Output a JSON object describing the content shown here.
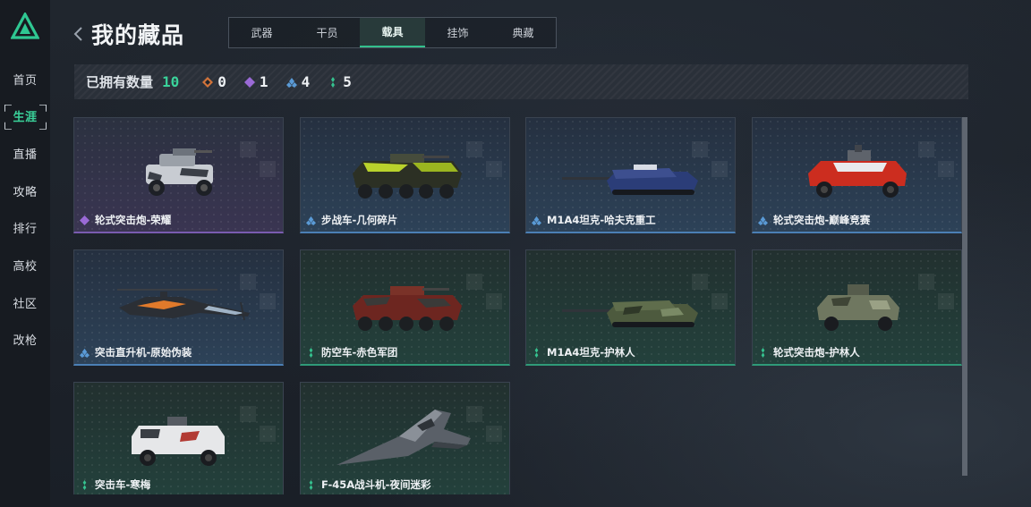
{
  "app": {
    "logo_icon": "triangle-logo-icon",
    "brand_color": "#3ad29a"
  },
  "sidebar": {
    "items": [
      {
        "label": "首页",
        "active": false
      },
      {
        "label": "生涯",
        "active": true
      },
      {
        "label": "直播",
        "active": false
      },
      {
        "label": "攻略",
        "active": false
      },
      {
        "label": "排行",
        "active": false
      },
      {
        "label": "高校",
        "active": false
      },
      {
        "label": "社区",
        "active": false
      },
      {
        "label": "改枪",
        "active": false
      }
    ]
  },
  "header": {
    "back_icon": "chevron-left-icon",
    "title": "我的藏品",
    "tabs": [
      {
        "label": "武器",
        "active": false
      },
      {
        "label": "干员",
        "active": false
      },
      {
        "label": "载具",
        "active": true
      },
      {
        "label": "挂饰",
        "active": false
      },
      {
        "label": "典藏",
        "active": false
      }
    ]
  },
  "stats": {
    "owned_label": "已拥有数量",
    "owned_total": "10",
    "rarities": [
      {
        "icon": "orange-diamond-icon",
        "color": "#d3743a",
        "count": "0"
      },
      {
        "icon": "purple-diamond-icon",
        "color": "#9a6ad6",
        "count": "1"
      },
      {
        "icon": "blue-diamond-icon",
        "color": "#5a9ad6",
        "count": "4"
      },
      {
        "icon": "green-diamond-icon",
        "color": "#35c28f",
        "count": "5"
      }
    ]
  },
  "collection": {
    "items": [
      {
        "name": "轮式突击炮-荣耀",
        "rarity": "purple",
        "vehicle": "armored-car"
      },
      {
        "name": "步战车-几何碎片",
        "rarity": "blue",
        "vehicle": "ifv"
      },
      {
        "name": "M1A4坦克-哈夫克重工",
        "rarity": "blue",
        "vehicle": "tank"
      },
      {
        "name": "轮式突击炮-巅峰竞赛",
        "rarity": "blue",
        "vehicle": "armored-car"
      },
      {
        "name": "突击直升机-原始伪装",
        "rarity": "blue",
        "vehicle": "helicopter"
      },
      {
        "name": "防空车-赤色军团",
        "rarity": "green",
        "vehicle": "ifv"
      },
      {
        "name": "M1A4坦克-护林人",
        "rarity": "green",
        "vehicle": "tank"
      },
      {
        "name": "轮式突击炮-护林人",
        "rarity": "green",
        "vehicle": "armored-car"
      },
      {
        "name": "突击车-寒梅",
        "rarity": "green",
        "vehicle": "mrap"
      },
      {
        "name": "F-45A战斗机-夜间迷彩",
        "rarity": "green",
        "vehicle": "jet"
      }
    ]
  }
}
